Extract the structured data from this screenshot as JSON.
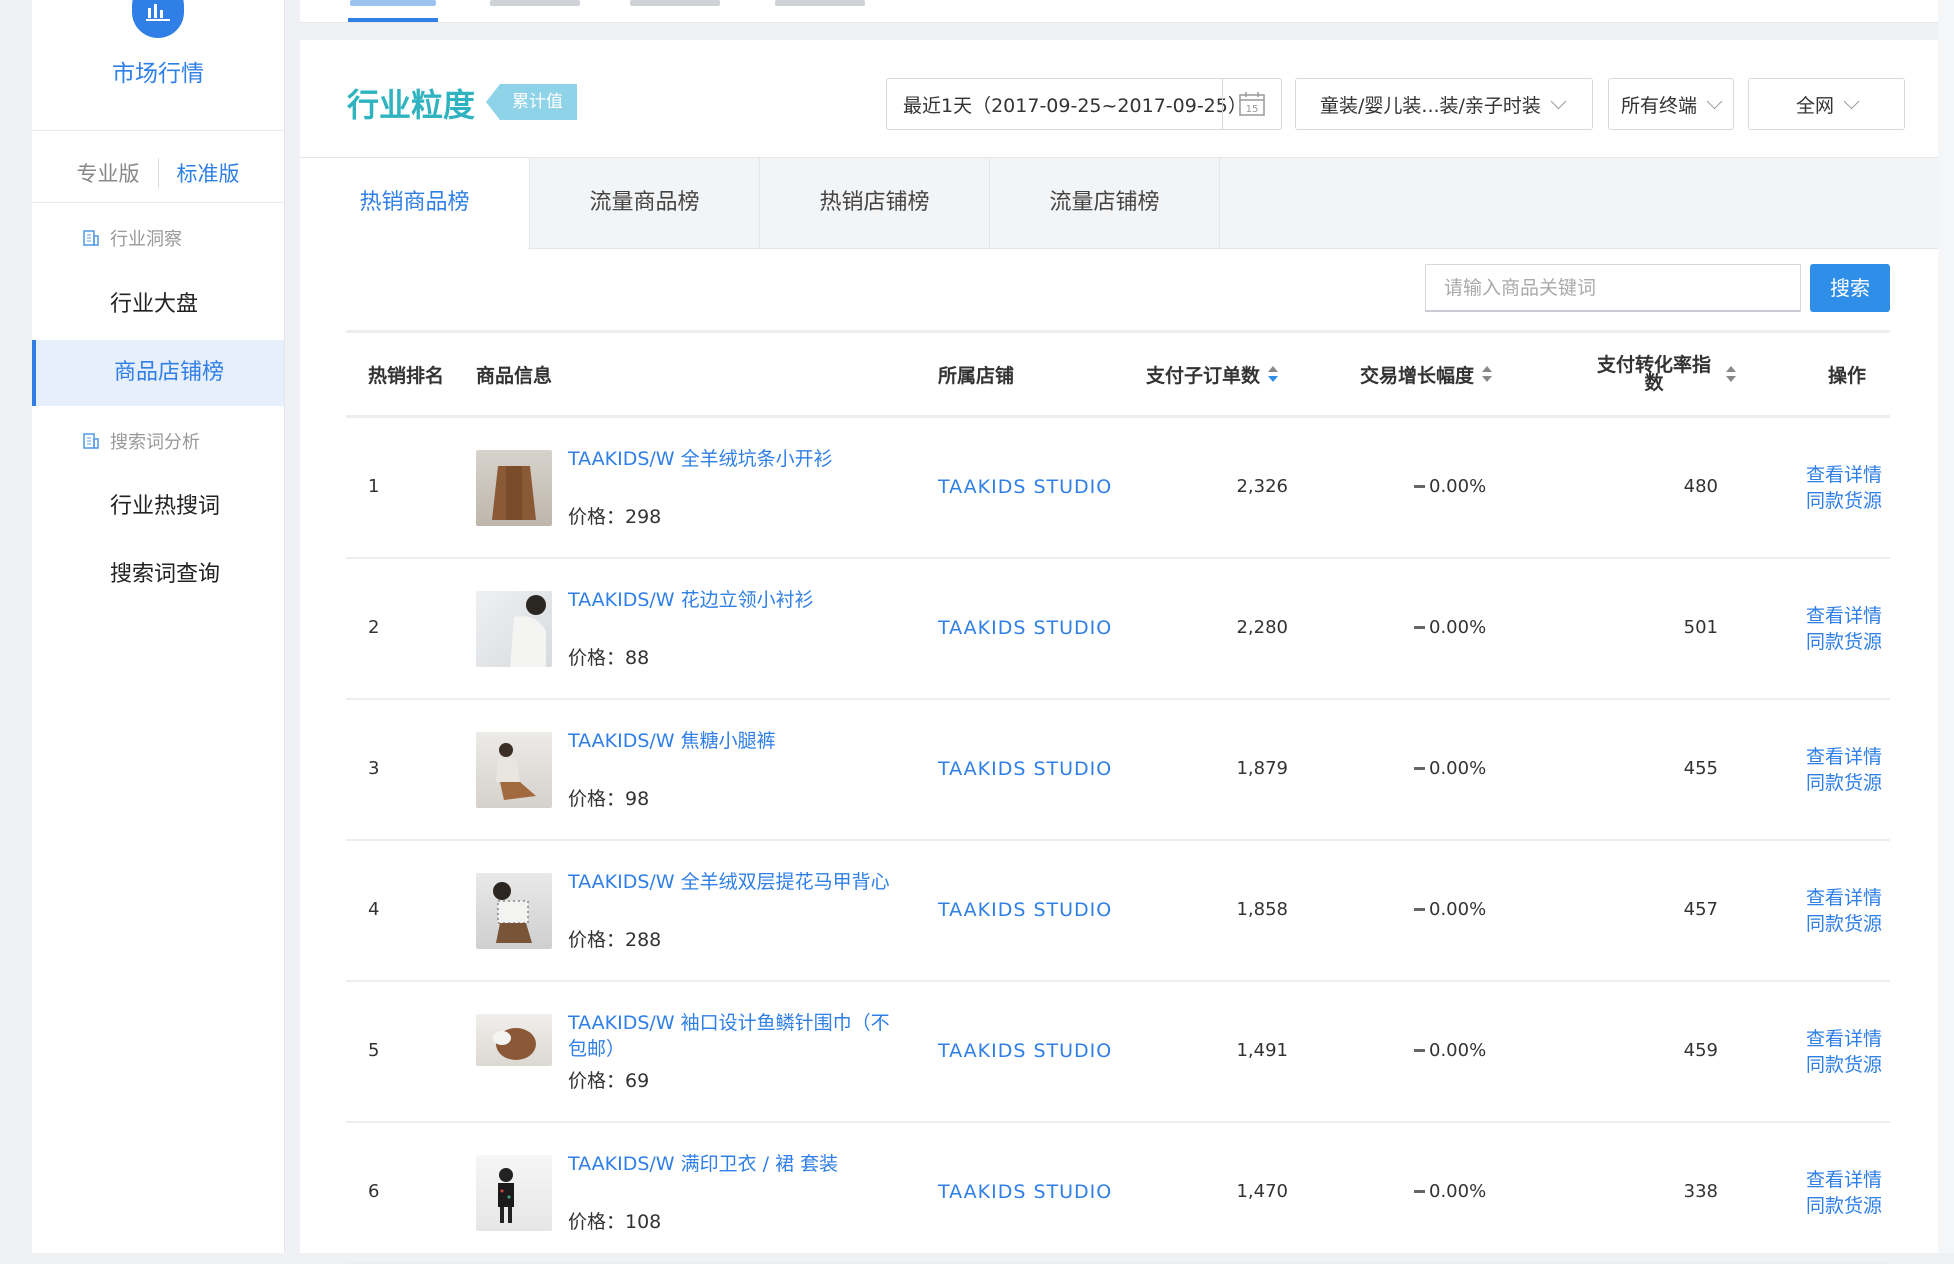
{
  "sidebar": {
    "app_title": "市场行情",
    "version_pro": "专业版",
    "version_std": "标准版",
    "groups": [
      {
        "label": "行业洞察",
        "items": [
          "行业大盘",
          "商品店铺榜"
        ]
      },
      {
        "label": "搜索词分析",
        "items": [
          "行业热搜词",
          "搜索词查询"
        ]
      }
    ],
    "active_item": "商品店铺榜"
  },
  "header": {
    "title": "行业粒度",
    "tag": "累计值",
    "date_range": "最近1天（2017-09-25~2017-09-25）",
    "calendar_day": "15",
    "category": "童装/婴儿装...装/亲子时装",
    "terminal": "所有终端",
    "network": "全网"
  },
  "tabs": [
    "热销商品榜",
    "流量商品榜",
    "热销店铺榜",
    "流量店铺榜"
  ],
  "search": {
    "placeholder": "请输入商品关键词",
    "button": "搜索"
  },
  "table": {
    "headers": {
      "rank": "热销排名",
      "product": "商品信息",
      "shop": "所属店铺",
      "orders": "支付子订单数",
      "growth": "交易增长幅度",
      "conversion": "支付转化率指数",
      "ops": "操作"
    },
    "price_prefix": "价格：",
    "op_detail": "查看详情",
    "op_source": "同款货源",
    "rows": [
      {
        "rank": "1",
        "name": "TAAKIDS/W 全羊绒坑条小开衫",
        "price": "价格：298",
        "shop": "TAAKIDS STUDIO",
        "orders": "2,326",
        "growth": "0.00%",
        "conversion": "480"
      },
      {
        "rank": "2",
        "name": "TAAKIDS/W 花边立领小衬衫",
        "price": "价格：88",
        "shop": "TAAKIDS STUDIO",
        "orders": "2,280",
        "growth": "0.00%",
        "conversion": "501"
      },
      {
        "rank": "3",
        "name": "TAAKIDS/W 焦糖小腿裤",
        "price": "价格：98",
        "shop": "TAAKIDS STUDIO",
        "orders": "1,879",
        "growth": "0.00%",
        "conversion": "455"
      },
      {
        "rank": "4",
        "name": "TAAKIDS/W 全羊绒双层提花马甲背心",
        "price": "价格：288",
        "shop": "TAAKIDS STUDIO",
        "orders": "1,858",
        "growth": "0.00%",
        "conversion": "457"
      },
      {
        "rank": "5",
        "name": "TAAKIDS/W 袖口设计鱼鳞针围巾（不包邮）",
        "price": "价格：69",
        "shop": "TAAKIDS STUDIO",
        "orders": "1,491",
        "growth": "0.00%",
        "conversion": "459"
      },
      {
        "rank": "6",
        "name": "TAAKIDS/W 满印卫衣 / 裙 套装",
        "price": "价格：108",
        "shop": "TAAKIDS STUDIO",
        "orders": "1,470",
        "growth": "0.00%",
        "conversion": "338"
      }
    ]
  },
  "colors": {
    "accent": "#2f7fe6",
    "title_teal": "#2fb3c0",
    "tag_bg": "#8fd3e8"
  }
}
